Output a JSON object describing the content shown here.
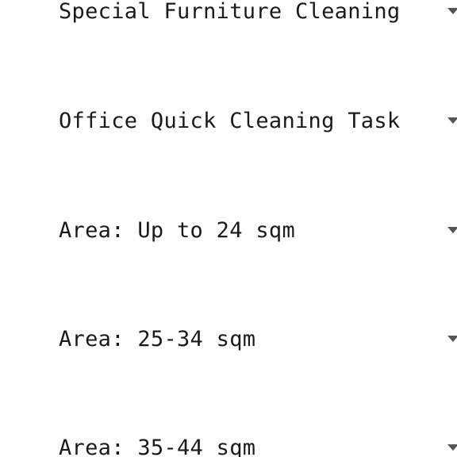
{
  "accordion": {
    "items": [
      {
        "label": "Special Furniture Cleaning",
        "icon": "chevron-down-icon"
      },
      {
        "label": "Office Quick Cleaning Task",
        "icon": "chevron-down-icon"
      },
      {
        "label": "Area: Up to 24 sqm",
        "icon": "chevron-down-icon"
      },
      {
        "label": "Area: 25-34 sqm",
        "icon": "chevron-down-icon"
      },
      {
        "label": "Area: 35-44 sqm",
        "icon": "chevron-down-icon"
      }
    ]
  }
}
